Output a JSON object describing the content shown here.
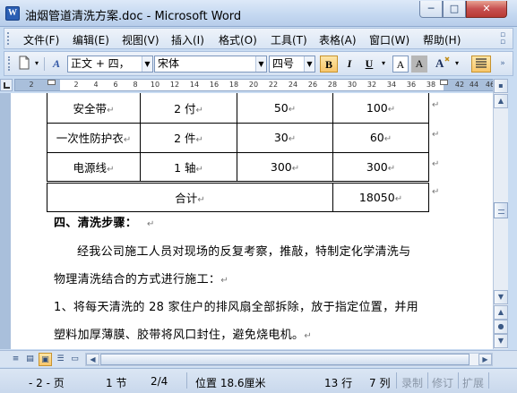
{
  "window": {
    "title": "油烟管道清洗方案.doc - Microsoft Word",
    "app_icon_letter": "W",
    "minimize": "─",
    "maximize": "□",
    "close": "✕"
  },
  "menu": [
    "文件(F)",
    "编辑(E)",
    "视图(V)",
    "插入(I)",
    "格式(O)",
    "工具(T)",
    "表格(A)",
    "窗口(W)",
    "帮助(H)"
  ],
  "toolbar": {
    "style": "正文 + 四，",
    "font": "宋体",
    "size": "四号",
    "bold": "B",
    "italic": "I",
    "underline": "U",
    "border_a": "A",
    "highlight_a": "A",
    "style_icon": "A",
    "pilcrow": "¶"
  },
  "ruler": {
    "left_numbers": [
      "2"
    ],
    "numbers": [
      "2",
      "4",
      "6",
      "8",
      "10",
      "12",
      "14",
      "16",
      "18",
      "20",
      "22",
      "24",
      "26",
      "28",
      "30",
      "32",
      "34",
      "36",
      "38",
      "42",
      "44",
      "46"
    ]
  },
  "table": {
    "rows": [
      [
        "安全带",
        "2 付",
        "50",
        "100"
      ],
      [
        "一次性防护衣",
        "2 件",
        "30",
        "60"
      ],
      [
        "电源线",
        "1 轴",
        "300",
        "300"
      ]
    ],
    "total_label": "合计",
    "total_value": "18050"
  },
  "document": {
    "para_mark": "↵",
    "heading": "四、清洗步骤：",
    "p1_line1": "经我公司施工人员对现场的反复考察，推敲，特制定化学清洗与",
    "p1_line2": "物理清洗结合的方式进行施工：",
    "p2_line1": "1、将每天清洗的 28 家住户的排风扇全部拆除，放于指定位置，并用",
    "p2_line2": "塑料加厚薄膜、胶带将风口封住，避免烧电机。"
  },
  "status": {
    "page": "- 2 - 页",
    "section": "1 节",
    "pages": "2/4",
    "position": "位置 18.6厘米",
    "line": "13 行",
    "column": "7 列",
    "rec": "录制",
    "trk": "修订",
    "ext": "扩展"
  }
}
